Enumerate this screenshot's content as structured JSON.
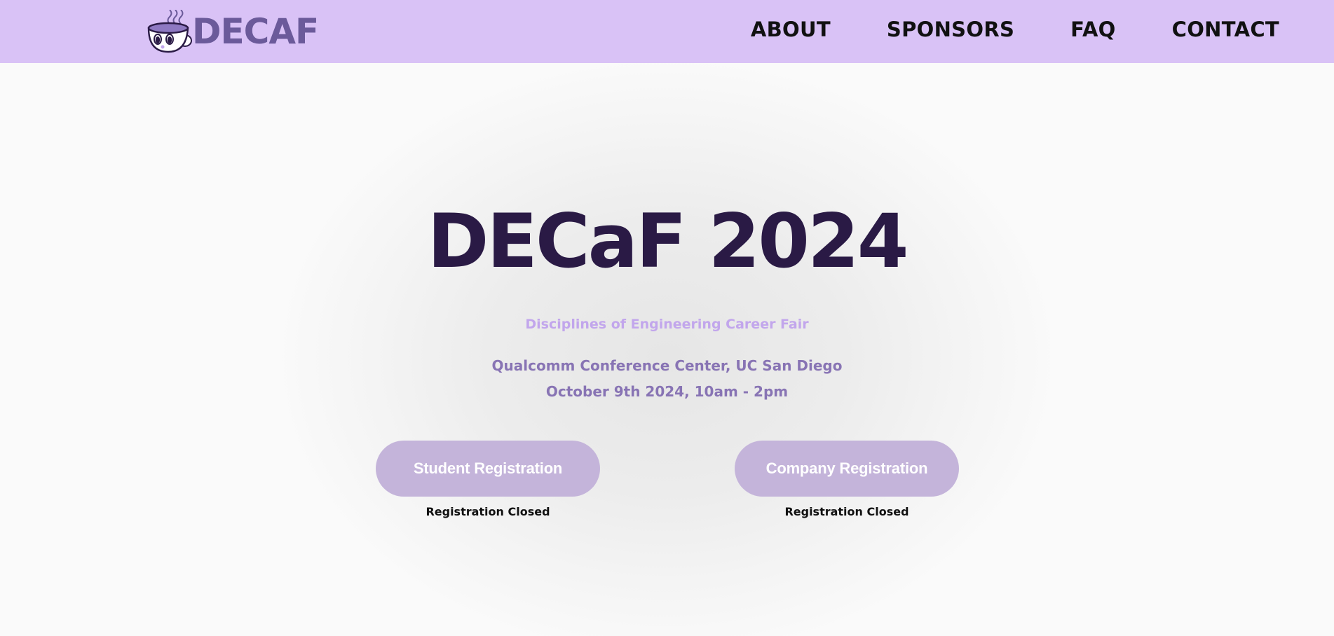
{
  "header": {
    "logo_text": "DECAF",
    "nav": [
      {
        "label": "ABOUT"
      },
      {
        "label": "SPONSORS"
      },
      {
        "label": "FAQ"
      },
      {
        "label": "CONTACT"
      }
    ]
  },
  "hero": {
    "title": "DECaF 2024",
    "subtitle": "Disciplines of Engineering Career Fair",
    "venue": "Qualcomm Conference Center, UC San Diego",
    "date": "October 9th 2024, 10am - 2pm"
  },
  "registration": {
    "student": {
      "label": "Student Registration",
      "status": "Registration Closed"
    },
    "company": {
      "label": "Company Registration",
      "status": "Registration Closed"
    }
  },
  "colors": {
    "header_bg": "#d9c2f6",
    "logo": "#6b5a9a",
    "title": "#2a1a45",
    "subtitle": "#c2a6ec",
    "details": "#8874b4",
    "button_bg": "#c4b4da"
  },
  "icons": {
    "logo_mascot": "coffee-cup-mascot-icon"
  }
}
